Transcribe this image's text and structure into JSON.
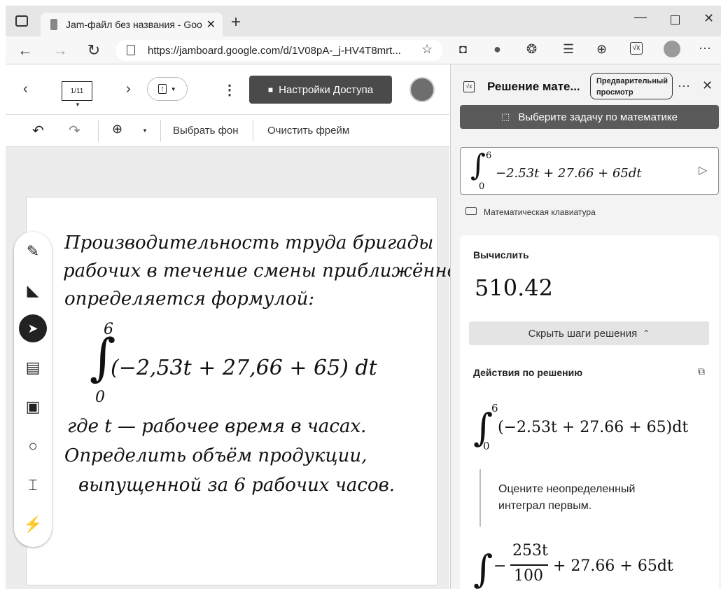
{
  "browser": {
    "tab_title": "Jam-файл без названия - Google",
    "url": "https://jamboard.google.com/d/1V08pA-_j-HV4T8mrt..."
  },
  "jamboard": {
    "frame_counter": "1/11",
    "share_button": "Настройки Доступа",
    "set_background": "Выбрать фон",
    "clear_frame": "Очистить фрейм",
    "handwriting": {
      "line1": "Производительность труда бригады",
      "line2": "рабочих в течение смены приближённо",
      "line3": "определяется формулой:",
      "upper_limit": "6",
      "lower_limit": "0",
      "integrand": "(−2,53t + 27,66 + 65) dt",
      "line5": "где t — рабочее время в часах.",
      "line6": "Определить объём продукции,",
      "line7": "выпущенной за 6 рабочих часов."
    }
  },
  "math_panel": {
    "title": "Решение мате...",
    "preview_badge_line1": "Предварительный",
    "preview_badge_line2": "просмотр",
    "select_problem": "Выберите задачу по математике",
    "input_upper": "6",
    "input_lower": "0",
    "input_expression": "−2.53t + 27.66 + 65dt",
    "math_keyboard": "Математическая клавиатура",
    "compute_label": "Вычислить",
    "result": "510.42",
    "hide_steps": "Скрыть шаги решения",
    "solution_steps_label": "Действия по решению",
    "step1_upper": "6",
    "step1_lower": "0",
    "step1_expression": "(−2.53t + 27.66 + 65)dt",
    "step_note_line1": "Оцените неопределенный",
    "step_note_line2": "интеграл первым.",
    "step2_numerator": "253t",
    "step2_denominator": "100",
    "step2_rest": "+ 27.66 + 65dt"
  }
}
